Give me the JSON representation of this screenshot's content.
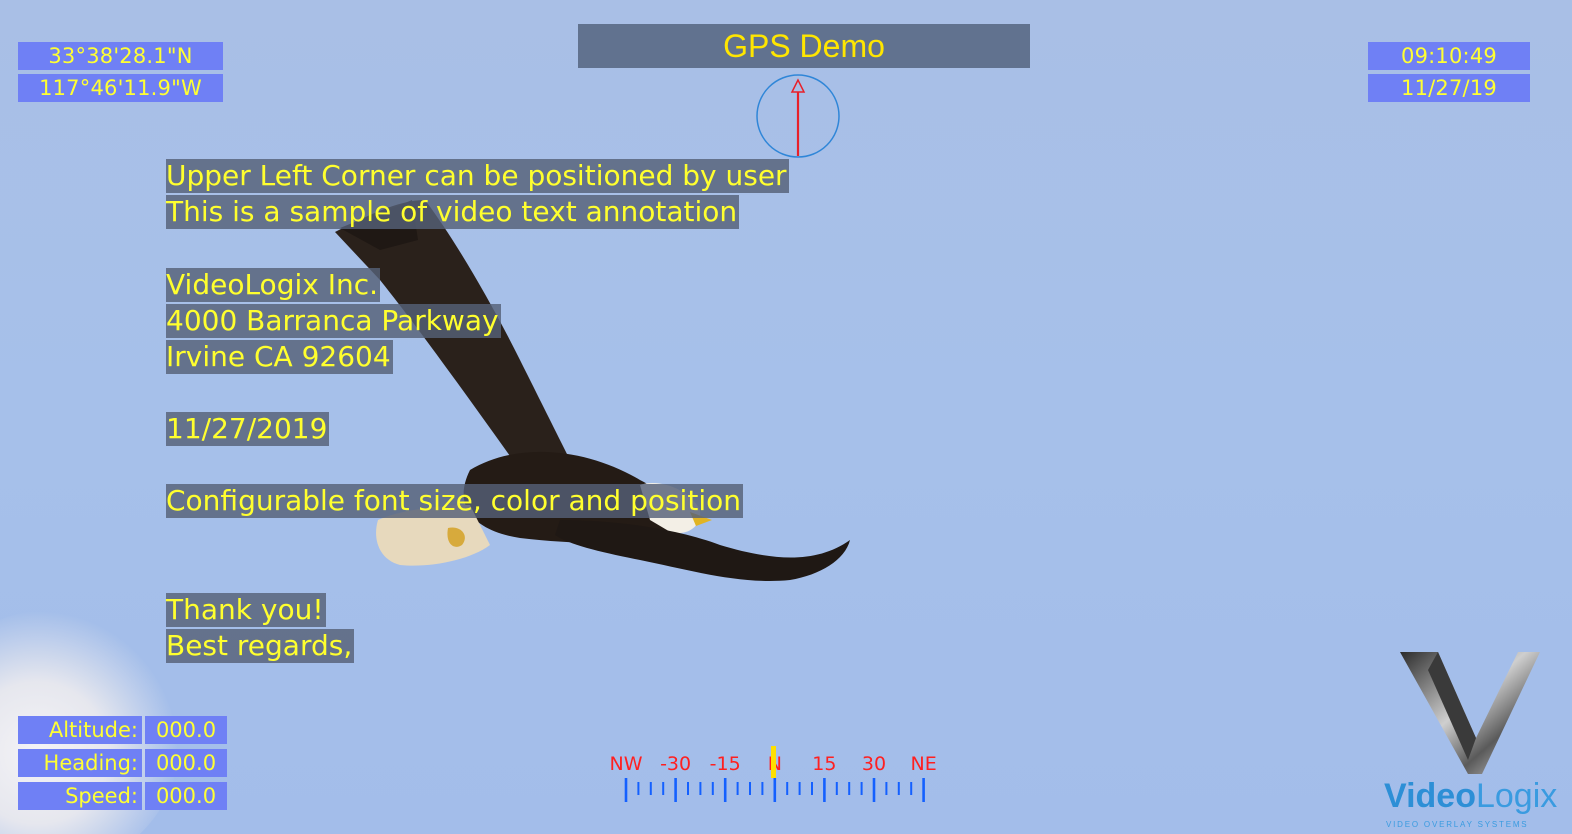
{
  "title": "GPS Demo",
  "gps": {
    "lat": "33°38'28.1\"N",
    "lon": "117°46'11.9\"W"
  },
  "clock": {
    "time": "09:10:49",
    "date": "11/27/19"
  },
  "annotations": [
    "Upper Left Corner can be positioned by user",
    "This is a sample of video text annotation",
    "VideoLogix Inc.",
    "4000 Barranca Parkway",
    "Irvine CA 92604",
    "11/27/2019",
    "Configurable font size, color and position",
    "Thank you!",
    "Best regards,"
  ],
  "telemetry": [
    {
      "label": "Altitude:",
      "value": "000.0"
    },
    {
      "label": "Heading:",
      "value": "000.0"
    },
    {
      "label": "Speed:",
      "value": "000.0"
    }
  ],
  "heading_scale": {
    "labels": [
      "NW",
      "-30",
      "-15",
      "N",
      "15",
      "30",
      "NE"
    ],
    "label_color": "#ff2020",
    "tick_color": "#1460ff",
    "pointer_color": "#ffe000"
  },
  "compass": {
    "heading_deg": 0,
    "ring_color": "#2f86d8",
    "needle_color": "#e8202a"
  },
  "logo": {
    "brand_bold": "Video",
    "brand_light": "Logix",
    "tagline": "VIDEO OVERLAY SYSTEMS",
    "color": "#2d8fd6"
  },
  "colors": {
    "overlay_text": "#ffff33",
    "box_bg": "#6f80f5",
    "title_bg": "#61728f",
    "title_text": "#ffe600"
  }
}
